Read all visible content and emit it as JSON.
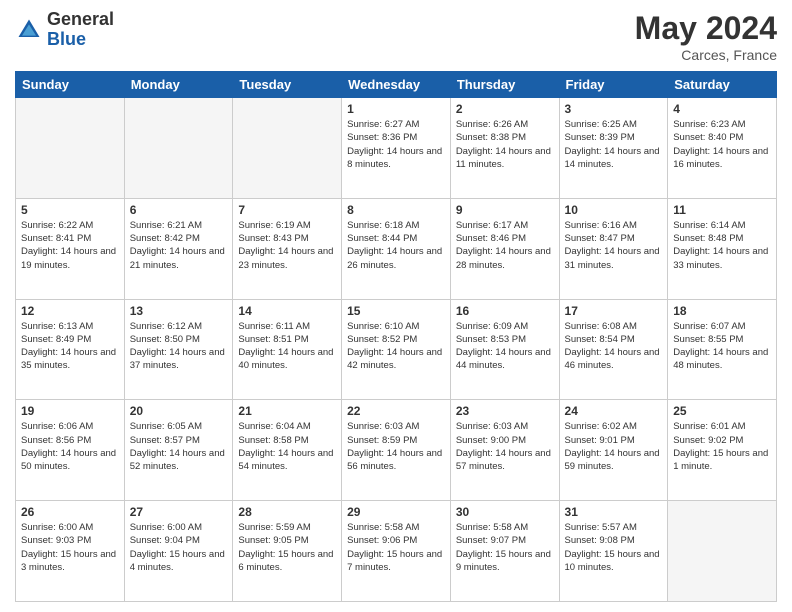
{
  "header": {
    "logo_general": "General",
    "logo_blue": "Blue",
    "month_title": "May 2024",
    "location": "Carces, France"
  },
  "days_of_week": [
    "Sunday",
    "Monday",
    "Tuesday",
    "Wednesday",
    "Thursday",
    "Friday",
    "Saturday"
  ],
  "weeks": [
    [
      {
        "day": "",
        "empty": true
      },
      {
        "day": "",
        "empty": true
      },
      {
        "day": "",
        "empty": true
      },
      {
        "day": "1",
        "sunrise": "6:27 AM",
        "sunset": "8:36 PM",
        "daylight": "14 hours and 8 minutes."
      },
      {
        "day": "2",
        "sunrise": "6:26 AM",
        "sunset": "8:38 PM",
        "daylight": "14 hours and 11 minutes."
      },
      {
        "day": "3",
        "sunrise": "6:25 AM",
        "sunset": "8:39 PM",
        "daylight": "14 hours and 14 minutes."
      },
      {
        "day": "4",
        "sunrise": "6:23 AM",
        "sunset": "8:40 PM",
        "daylight": "14 hours and 16 minutes."
      }
    ],
    [
      {
        "day": "5",
        "sunrise": "6:22 AM",
        "sunset": "8:41 PM",
        "daylight": "14 hours and 19 minutes."
      },
      {
        "day": "6",
        "sunrise": "6:21 AM",
        "sunset": "8:42 PM",
        "daylight": "14 hours and 21 minutes."
      },
      {
        "day": "7",
        "sunrise": "6:19 AM",
        "sunset": "8:43 PM",
        "daylight": "14 hours and 23 minutes."
      },
      {
        "day": "8",
        "sunrise": "6:18 AM",
        "sunset": "8:44 PM",
        "daylight": "14 hours and 26 minutes."
      },
      {
        "day": "9",
        "sunrise": "6:17 AM",
        "sunset": "8:46 PM",
        "daylight": "14 hours and 28 minutes."
      },
      {
        "day": "10",
        "sunrise": "6:16 AM",
        "sunset": "8:47 PM",
        "daylight": "14 hours and 31 minutes."
      },
      {
        "day": "11",
        "sunrise": "6:14 AM",
        "sunset": "8:48 PM",
        "daylight": "14 hours and 33 minutes."
      }
    ],
    [
      {
        "day": "12",
        "sunrise": "6:13 AM",
        "sunset": "8:49 PM",
        "daylight": "14 hours and 35 minutes."
      },
      {
        "day": "13",
        "sunrise": "6:12 AM",
        "sunset": "8:50 PM",
        "daylight": "14 hours and 37 minutes."
      },
      {
        "day": "14",
        "sunrise": "6:11 AM",
        "sunset": "8:51 PM",
        "daylight": "14 hours and 40 minutes."
      },
      {
        "day": "15",
        "sunrise": "6:10 AM",
        "sunset": "8:52 PM",
        "daylight": "14 hours and 42 minutes."
      },
      {
        "day": "16",
        "sunrise": "6:09 AM",
        "sunset": "8:53 PM",
        "daylight": "14 hours and 44 minutes."
      },
      {
        "day": "17",
        "sunrise": "6:08 AM",
        "sunset": "8:54 PM",
        "daylight": "14 hours and 46 minutes."
      },
      {
        "day": "18",
        "sunrise": "6:07 AM",
        "sunset": "8:55 PM",
        "daylight": "14 hours and 48 minutes."
      }
    ],
    [
      {
        "day": "19",
        "sunrise": "6:06 AM",
        "sunset": "8:56 PM",
        "daylight": "14 hours and 50 minutes."
      },
      {
        "day": "20",
        "sunrise": "6:05 AM",
        "sunset": "8:57 PM",
        "daylight": "14 hours and 52 minutes."
      },
      {
        "day": "21",
        "sunrise": "6:04 AM",
        "sunset": "8:58 PM",
        "daylight": "14 hours and 54 minutes."
      },
      {
        "day": "22",
        "sunrise": "6:03 AM",
        "sunset": "8:59 PM",
        "daylight": "14 hours and 56 minutes."
      },
      {
        "day": "23",
        "sunrise": "6:03 AM",
        "sunset": "9:00 PM",
        "daylight": "14 hours and 57 minutes."
      },
      {
        "day": "24",
        "sunrise": "6:02 AM",
        "sunset": "9:01 PM",
        "daylight": "14 hours and 59 minutes."
      },
      {
        "day": "25",
        "sunrise": "6:01 AM",
        "sunset": "9:02 PM",
        "daylight": "15 hours and 1 minute."
      }
    ],
    [
      {
        "day": "26",
        "sunrise": "6:00 AM",
        "sunset": "9:03 PM",
        "daylight": "15 hours and 3 minutes."
      },
      {
        "day": "27",
        "sunrise": "6:00 AM",
        "sunset": "9:04 PM",
        "daylight": "15 hours and 4 minutes."
      },
      {
        "day": "28",
        "sunrise": "5:59 AM",
        "sunset": "9:05 PM",
        "daylight": "15 hours and 6 minutes."
      },
      {
        "day": "29",
        "sunrise": "5:58 AM",
        "sunset": "9:06 PM",
        "daylight": "15 hours and 7 minutes."
      },
      {
        "day": "30",
        "sunrise": "5:58 AM",
        "sunset": "9:07 PM",
        "daylight": "15 hours and 9 minutes."
      },
      {
        "day": "31",
        "sunrise": "5:57 AM",
        "sunset": "9:08 PM",
        "daylight": "15 hours and 10 minutes."
      },
      {
        "day": "",
        "empty": true
      }
    ]
  ]
}
